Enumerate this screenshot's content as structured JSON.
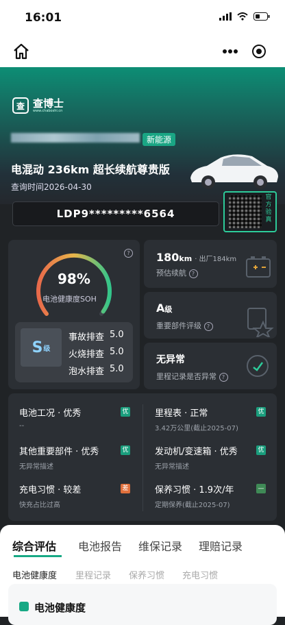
{
  "status_bar": {
    "time": "16:01"
  },
  "header": {
    "logo_text": "查博士",
    "logo_site": "www.chaboshi.cn",
    "tag": "新能源",
    "model": "电混动 236km 超长续航尊贵版",
    "query_time": "查询时间2026-04-30",
    "vin": "LDP9*********6564",
    "qr_label": "官方验真"
  },
  "battery": {
    "soh_value": "98%",
    "soh_label": "电池健康度SOH",
    "grade": "S",
    "grade_unit": "级",
    "checks": [
      {
        "label": "事故排查",
        "value": "5.0"
      },
      {
        "label": "火烧排查",
        "value": "5.0"
      },
      {
        "label": "泡水排查",
        "value": "5.0"
      }
    ],
    "gauge_level": 0.98
  },
  "range_card": {
    "value": "180",
    "unit": "km",
    "factory": "· 出厂184km",
    "label": "预估续航"
  },
  "parts_card": {
    "value": "A",
    "unit": "级",
    "label": "重要部件评级"
  },
  "mileage_card": {
    "value": "无异常",
    "label": "里程记录是否异常"
  },
  "summary": [
    {
      "title": "电池工况 · 优秀",
      "sub": "--",
      "badge": "优",
      "badge_color": "#1a9e7d"
    },
    {
      "title": "里程表 · 正常",
      "sub": "3.42万公里(截止2025-07)",
      "badge": "优",
      "badge_color": "#1a9e7d"
    },
    {
      "title": "其他重要部件 · 优秀",
      "sub": "无异常描述",
      "badge": "优",
      "badge_color": "#1a9e7d"
    },
    {
      "title": "发动机/变速箱 · 优秀",
      "sub": "无异常描述",
      "badge": "优",
      "badge_color": "#1a9e7d"
    },
    {
      "title": "充电习惯 · 较差",
      "sub": "快充占比过高",
      "badge": "差",
      "badge_color": "#e0703c"
    },
    {
      "title": "保养习惯 · 1.9次/年",
      "sub": "定期保养(截止2025-07)",
      "badge": "—",
      "badge_color": "#3f8a56"
    }
  ],
  "tabs": [
    "综合评估",
    "电池报告",
    "维保记录",
    "理赔记录"
  ],
  "subtabs": [
    "电池健康度",
    "里程记录",
    "保养习惯",
    "充电习惯"
  ],
  "bottom_card": {
    "title": "电池健康度"
  }
}
